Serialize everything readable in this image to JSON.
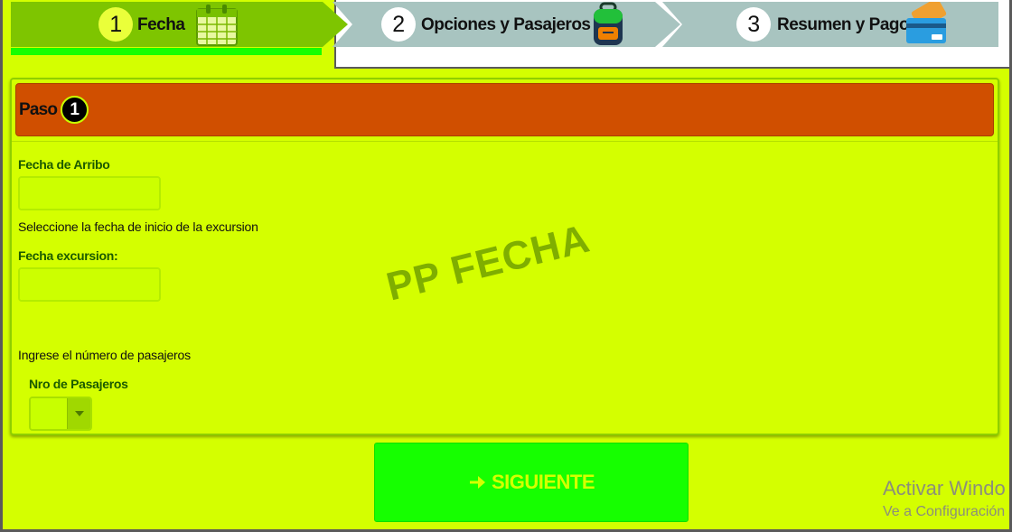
{
  "wizard": {
    "steps": [
      {
        "number": "1",
        "label": "Fecha",
        "icon": "calendar-icon",
        "active": true
      },
      {
        "number": "2",
        "label": "Opciones y Pasajeros",
        "icon": "backpack-icon",
        "active": false
      },
      {
        "number": "3",
        "label": "Resumen y Pago",
        "icon": "credit-card-icon",
        "active": false
      }
    ]
  },
  "panel": {
    "heading": "Paso",
    "step_number": "1",
    "fecha_arribo_label": "Fecha de Arribo",
    "fecha_arribo_value": "",
    "fecha_inicio_help": "Seleccione la fecha de inicio de la excursion",
    "fecha_excursion_label": "Fecha excursion:",
    "fecha_excursion_value": "",
    "pasajeros_help": "Ingrese el número de pasajeros",
    "nro_pasajeros_label": "Nro de Pasajeros",
    "nro_pasajeros_value": ""
  },
  "watermark": "PP FECHA",
  "next_button": {
    "label": "SIGUIENTE",
    "icon": "arrow-right-icon"
  },
  "windows_activation": {
    "title": "Activar Windo",
    "subtitle": "Ve a Configuración"
  },
  "colors": {
    "background": "#d4ff00",
    "active_step": "#7ec500",
    "inactive_step": "#a8c4c0",
    "panel_header": "#d04f00",
    "next_button": "#16ff00"
  }
}
